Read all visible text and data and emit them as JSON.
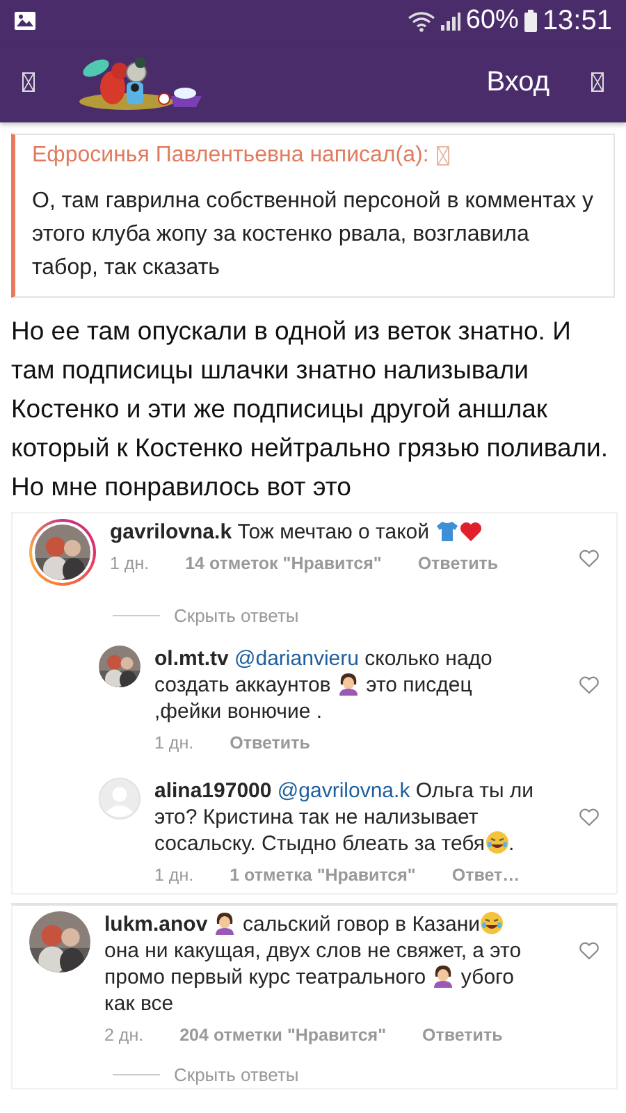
{
  "status_bar": {
    "battery": "60%",
    "time": "13:51"
  },
  "header": {
    "login": "Вход"
  },
  "quote": {
    "author": "Ефросинья Павлентьевна написал(а):",
    "text": "О, там гаврилна собственной персоной в комментах у этого клуба жопу за костенко рвала, возглавила табор, так сказать"
  },
  "post_text": "Но ее там опускали в одной из веток знатно. И там подписицы шлачки знатно нализывали Костенко и эти же подписицы другой аншлак который к Костенко нейтрально грязью поливали. Но мне понравилось вот это",
  "comments": [
    {
      "username": "gavrilovna.k",
      "avatar": {
        "kind": "picture"
      },
      "story_ring": true,
      "parts": [
        {
          "kind": "text",
          "text": "Тож мечтаю о такой "
        },
        {
          "kind": "shirt"
        },
        {
          "kind": "heart"
        }
      ],
      "time": "1 дн.",
      "likes": "14 отметок \"Нравится\"",
      "reply": "Ответить",
      "replies_toggle": "Скрыть ответы",
      "replies": [
        {
          "username": "ol.mt.tv",
          "avatar": {
            "kind": "picture"
          },
          "story_ring": false,
          "parts": [
            {
              "kind": "mention",
              "text": "@darianvieru"
            },
            {
              "kind": "text",
              "text": " сколько надо создать аккаунтов "
            },
            {
              "kind": "facepalm"
            },
            {
              "kind": "text",
              "text": " это писдец ,фейки вонючие ."
            }
          ],
          "time": "1 дн.",
          "reply": "Ответить"
        },
        {
          "username": "alina197000",
          "avatar": {
            "kind": "placeholder"
          },
          "story_ring": false,
          "parts": [
            {
              "kind": "mention",
              "text": "@gavrilovna.k"
            },
            {
              "kind": "text",
              "text": " Ольга ты ли это? Кристина так не нализывает сосальску. Стыдно блеать за тебя"
            },
            {
              "kind": "laugh"
            },
            {
              "kind": "text",
              "text": "."
            }
          ],
          "time": "1 дн.",
          "likes": "1 отметка \"Нравится\"",
          "reply": "Ответ…"
        }
      ]
    },
    {
      "username": "lukm.anov",
      "avatar": {
        "kind": "picture"
      },
      "story_ring": false,
      "parts": [
        {
          "kind": "facepalm"
        },
        {
          "kind": "text",
          "text": " сальский говор в Казани"
        },
        {
          "kind": "laugh"
        },
        {
          "kind": "text",
          "text": " она ни какущая, двух слов не свяжет, а это промо первый курс театрального "
        },
        {
          "kind": "facepalm"
        },
        {
          "kind": "text",
          "text": " убого как все"
        }
      ],
      "time": "2 дн.",
      "likes": "204 отметки \"Нравится\"",
      "reply": "Ответить",
      "replies_toggle": "Скрыть ответы"
    }
  ]
}
